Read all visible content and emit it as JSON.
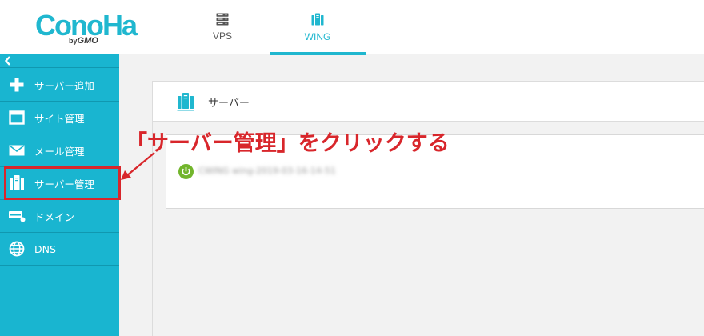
{
  "header": {
    "logo_text": "ConoHa",
    "logo_by": "by",
    "logo_gmo": "GMO",
    "tabs": [
      {
        "label": "VPS",
        "icon": "server-rack-icon",
        "active": false
      },
      {
        "label": "WING",
        "icon": "wing-servers-icon",
        "active": true
      }
    ]
  },
  "sidebar": {
    "collapse_icon": "chevron-left-icon",
    "items": [
      {
        "label": "サーバー追加",
        "icon": "plus-icon"
      },
      {
        "label": "サイト管理",
        "icon": "window-icon"
      },
      {
        "label": "メール管理",
        "icon": "mail-icon"
      },
      {
        "label": "サーバー管理",
        "icon": "server-icon",
        "highlighted": true
      },
      {
        "label": "ドメイン",
        "icon": "domain-icon"
      },
      {
        "label": "DNS",
        "icon": "globe-icon"
      }
    ]
  },
  "main": {
    "panel_title": "サーバー",
    "server_name": "CWING wing-2019-03-16-14-51",
    "server_status_icon": "power-on-icon"
  },
  "annotation": {
    "text": "「サーバー管理」をクリックする"
  },
  "colors": {
    "brand": "#19b5d0",
    "accent": "#20b7cf",
    "annotation_red": "#d8262b",
    "status_green": "#72b52c"
  }
}
